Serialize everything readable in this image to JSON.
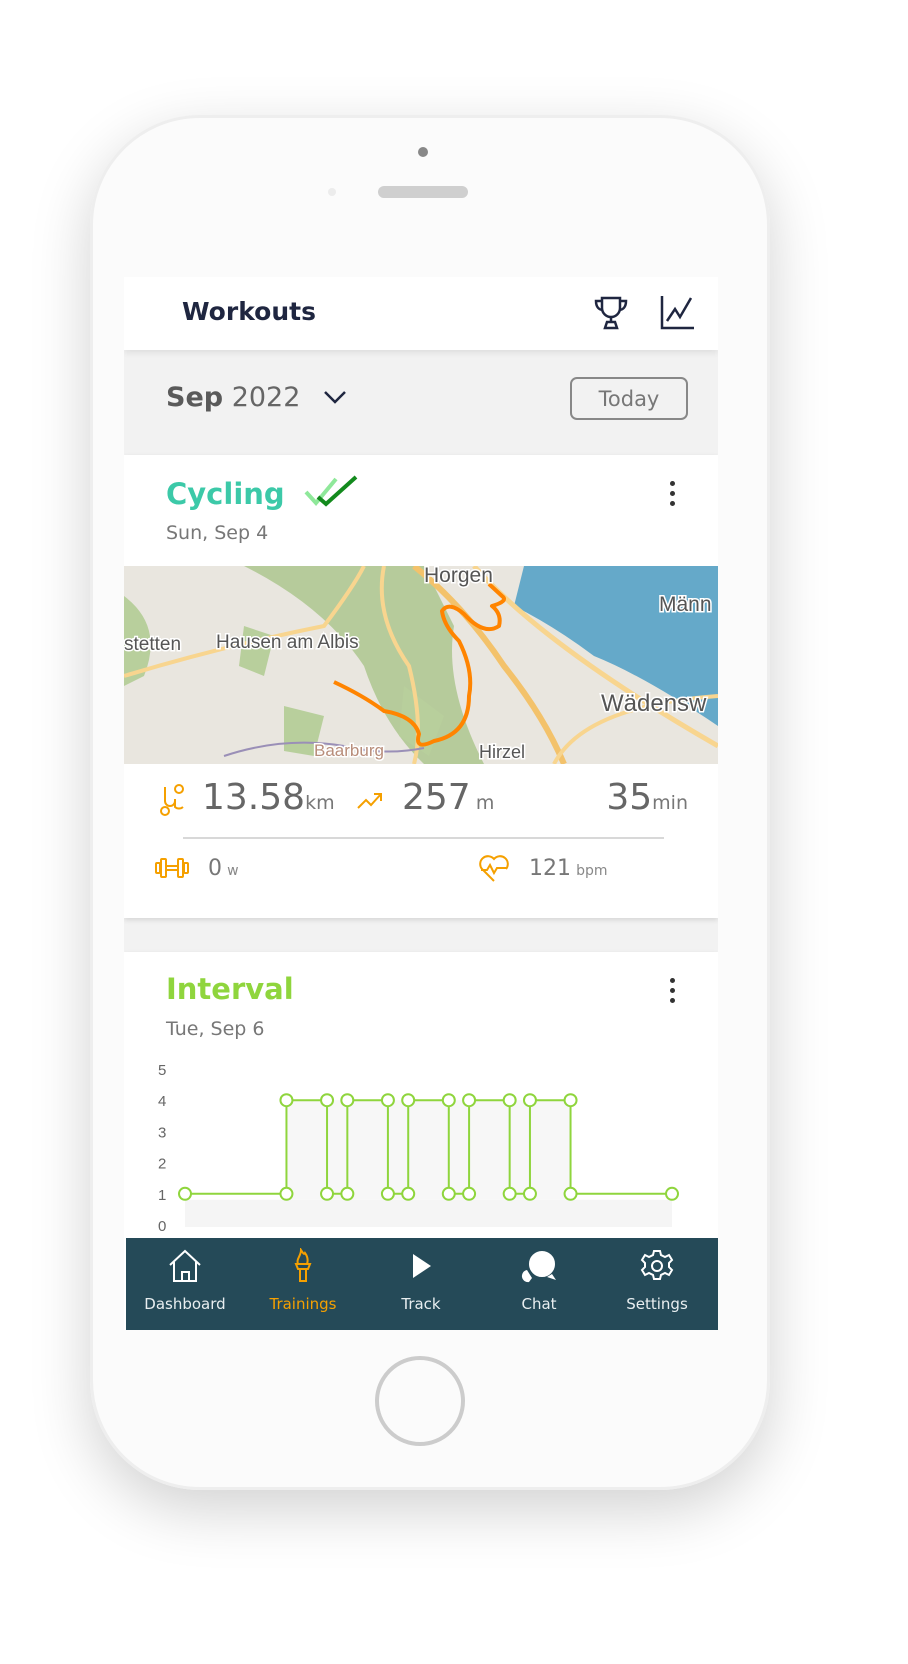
{
  "header": {
    "title": "Workouts",
    "icons": [
      "trophy-icon",
      "chart-line-icon"
    ]
  },
  "month_bar": {
    "month": "Sep",
    "year": "2022",
    "today_label": "Today"
  },
  "colors": {
    "cycling": "#3cc9a8",
    "interval": "#8fd53d",
    "accent": "#f5a000",
    "nav_bg": "#254a58",
    "route": "#ff8400"
  },
  "workouts": [
    {
      "title": "Cycling",
      "date": "Sun, Sep 4",
      "completed": true,
      "map_labels": {
        "horgen": "Horgen",
        "mann": "Männ",
        "stetten": "stetten",
        "hausen": "Hausen am Albis",
        "wadensw": "Wädensw",
        "baarburg": "Baarburg",
        "hirzel": "Hirzel"
      },
      "stats": {
        "distance": "13.58",
        "distance_unit": "km",
        "elevation": "257",
        "elevation_unit": "m",
        "duration": "35",
        "duration_unit": "min",
        "power": "0",
        "power_unit": "w",
        "heart_rate": "121",
        "heart_rate_unit": "bpm"
      }
    },
    {
      "title": "Interval",
      "date": "Tue, Sep 6"
    }
  ],
  "chart_data": {
    "type": "line",
    "title": "",
    "xlabel": "",
    "ylabel": "",
    "ylim": [
      0,
      5
    ],
    "yticks": [
      "0",
      "1",
      "2",
      "3",
      "4",
      "5"
    ],
    "grid": false,
    "series": [
      {
        "step": true,
        "points": [
          [
            0,
            1
          ],
          [
            5,
            1
          ],
          [
            5,
            4
          ],
          [
            7,
            4
          ],
          [
            7,
            1
          ],
          [
            8,
            1
          ],
          [
            8,
            4
          ],
          [
            10,
            4
          ],
          [
            10,
            1
          ],
          [
            11,
            1
          ],
          [
            11,
            4
          ],
          [
            13,
            4
          ],
          [
            13,
            1
          ],
          [
            14,
            1
          ],
          [
            14,
            4
          ],
          [
            16,
            4
          ],
          [
            16,
            1
          ],
          [
            17,
            1
          ],
          [
            17,
            4
          ],
          [
            19,
            4
          ],
          [
            19,
            1
          ],
          [
            24,
            1
          ]
        ]
      }
    ]
  },
  "nav": [
    {
      "label": "Dashboard",
      "icon": "home-icon",
      "active": false
    },
    {
      "label": "Trainings",
      "icon": "torch-icon",
      "active": true
    },
    {
      "label": "Track",
      "icon": "play-icon",
      "active": false
    },
    {
      "label": "Chat",
      "icon": "chat-icon",
      "active": false
    },
    {
      "label": "Settings",
      "icon": "gear-icon",
      "active": false
    }
  ]
}
